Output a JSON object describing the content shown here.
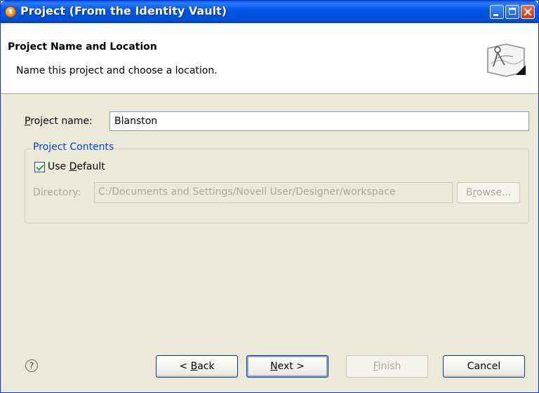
{
  "window": {
    "title": "Project (From the Identity Vault)"
  },
  "banner": {
    "title": "Project Name and Location",
    "description": "Name this project and choose a location."
  },
  "form": {
    "project_name_label_prefix": "P",
    "project_name_label_rest": "roject name:",
    "project_name_value": "Blanston",
    "group_title": "Project Contents",
    "use_default_checked": true,
    "use_default_pre": "Use ",
    "use_default_u": "D",
    "use_default_post": "efault",
    "directory_label": "Directory:",
    "directory_value": "C:/Documents and Settings/Novell User/Designer/workspace",
    "browse_pre": "B",
    "browse_u": "r",
    "browse_post": "owse..."
  },
  "buttons": {
    "back_pre": "< ",
    "back_u": "B",
    "back_post": "ack",
    "next_u": "N",
    "next_post": "ext >",
    "finish_u": "F",
    "finish_post": "inish",
    "cancel": "Cancel",
    "finish_enabled": false
  },
  "icons": {
    "help": "?"
  }
}
